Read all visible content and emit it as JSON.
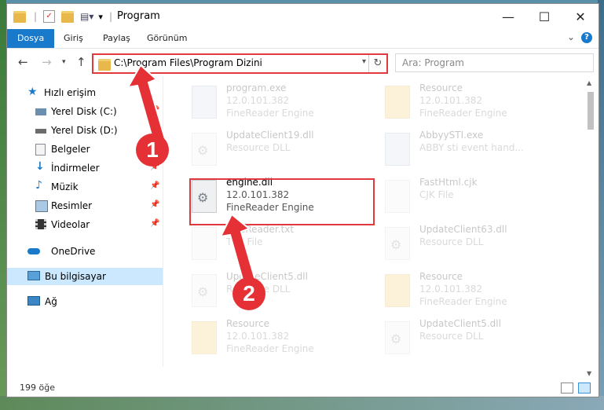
{
  "window": {
    "title": "Program"
  },
  "ribbon": {
    "tabs": [
      "Dosya",
      "Giriş",
      "Paylaş",
      "Görünüm"
    ],
    "help": "?"
  },
  "nav": {
    "address": "C:\\Program Files\\Program Dizini",
    "search_placeholder": "Ara: Program"
  },
  "sidebar": {
    "quick_access": "Hızlı erişim",
    "pinned": [
      "Yerel Disk (C:)",
      "Yerel Disk (D:)",
      "Belgeler",
      "İndirmeler",
      "Müzik",
      "Resimler",
      "Videolar"
    ],
    "onedrive": "OneDrive",
    "this_pc": "Bu bilgisayar",
    "network": "Ağ"
  },
  "files": [
    {
      "name": "program.exe",
      "l1": "12.0.101.382",
      "l2": "FineReader Engine",
      "icon": "exe-icon"
    },
    {
      "name": "Resource",
      "l1": "12.0.101.382",
      "l2": "FineReader Engine",
      "icon": "folder-icon"
    },
    {
      "name": "UpdateClient19.dll",
      "l1": "Resource DLL",
      "l2": "",
      "icon": "dll-icon"
    },
    {
      "name": "AbbyySTI.exe",
      "l1": "ABBY sti event hand...",
      "l2": "",
      "icon": "exe-icon"
    },
    {
      "name": "engine.dll",
      "l1": "12.0.101.382",
      "l2": "FineReader Engine",
      "icon": "dll-icon"
    },
    {
      "name": "FastHtml.cjk",
      "l1": "CJK File",
      "l2": "",
      "icon": "file-icon"
    },
    {
      "name": "FineReader.txt",
      "l1": "TXT File",
      "l2": "",
      "icon": "file-icon"
    },
    {
      "name": "UpdateClient63.dll",
      "l1": "Resource DLL",
      "l2": "",
      "icon": "dll-icon"
    },
    {
      "name": "UpdateClient5.dll",
      "l1": "Resource DLL",
      "l2": "",
      "icon": "dll-icon"
    },
    {
      "name": "Resource",
      "l1": "12.0.101.382",
      "l2": "FineReader Engine",
      "icon": "folder-icon"
    },
    {
      "name": "Resource",
      "l1": "12.0.101.382",
      "l2": "FineReader Engine",
      "icon": "folder-icon"
    },
    {
      "name": "UpdateClient5.dll",
      "l1": "Resource DLL",
      "l2": "",
      "icon": "dll-icon"
    }
  ],
  "status": {
    "count": "199 öğe"
  },
  "annotations": {
    "badge1": "1",
    "badge2": "2"
  },
  "colors": {
    "accent": "#1979ca",
    "highlight": "#e0393e",
    "selection": "#cce8ff"
  }
}
